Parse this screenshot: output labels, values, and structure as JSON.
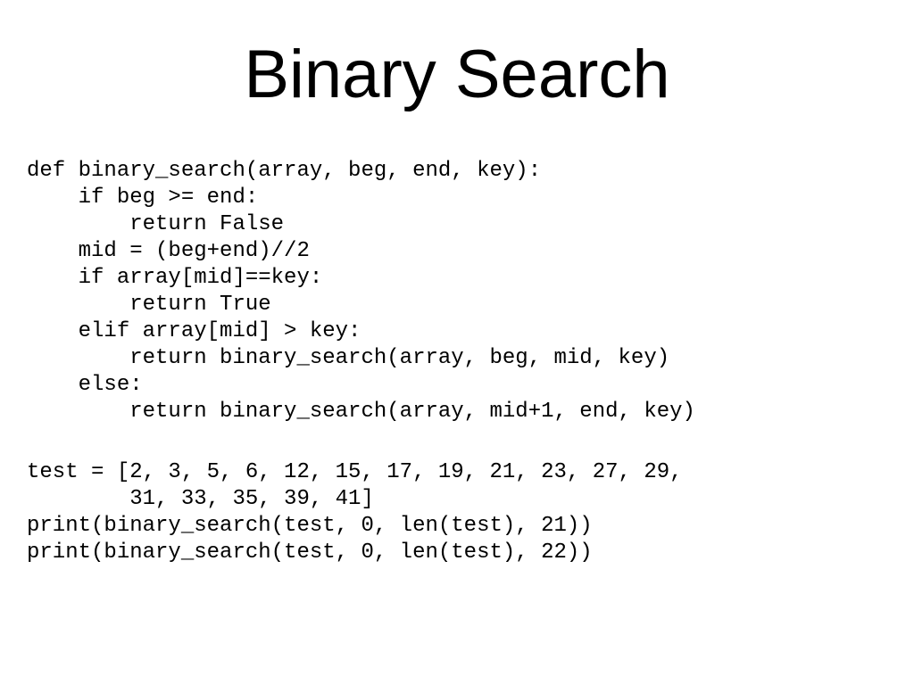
{
  "title": "Binary Search",
  "code": {
    "line1": "def binary_search(array, beg, end, key):",
    "line2": "    if beg >= end:",
    "line3": "        return False",
    "line4": "    mid = (beg+end)//2",
    "line5": "    if array[mid]==key:",
    "line6": "        return True",
    "line7": "    elif array[mid] > key:",
    "line8": "        return binary_search(array, beg, mid, key)",
    "line9": "    else:",
    "line10": "        return binary_search(array, mid+1, end, key)"
  },
  "test": {
    "line1": "test = [2, 3, 5, 6, 12, 15, 17, 19, 21, 23, 27, 29,",
    "line2": "        31, 33, 35, 39, 41]",
    "line3": "print(binary_search(test, 0, len(test), 21))",
    "line4": "print(binary_search(test, 0, len(test), 22))"
  }
}
